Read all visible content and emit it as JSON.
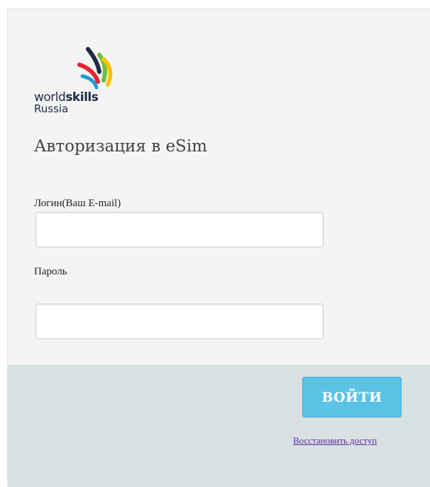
{
  "logo": {
    "line1_regular": "world",
    "line1_bold": "skills",
    "line2": "Russia",
    "colors": {
      "navy": "#1f2a44",
      "red": "#e3262e",
      "yellow": "#f5c400",
      "green": "#6cbf3b",
      "blue": "#1e9bd7"
    }
  },
  "form": {
    "title": "Авторизация в eSim",
    "login_label": "Логин(Ваш E-mail)",
    "login_value": "",
    "login_placeholder": "",
    "password_label": "Пароль",
    "password_value": "",
    "password_placeholder": ""
  },
  "footer": {
    "login_button_label": "ВОЙТИ",
    "restore_link_label": "Восстановить доступ"
  },
  "colors": {
    "form_background": "#f4f4f4",
    "footer_background": "#d9e1e3",
    "button_background": "#5bc3e4",
    "link_color": "#5a2a9c"
  }
}
